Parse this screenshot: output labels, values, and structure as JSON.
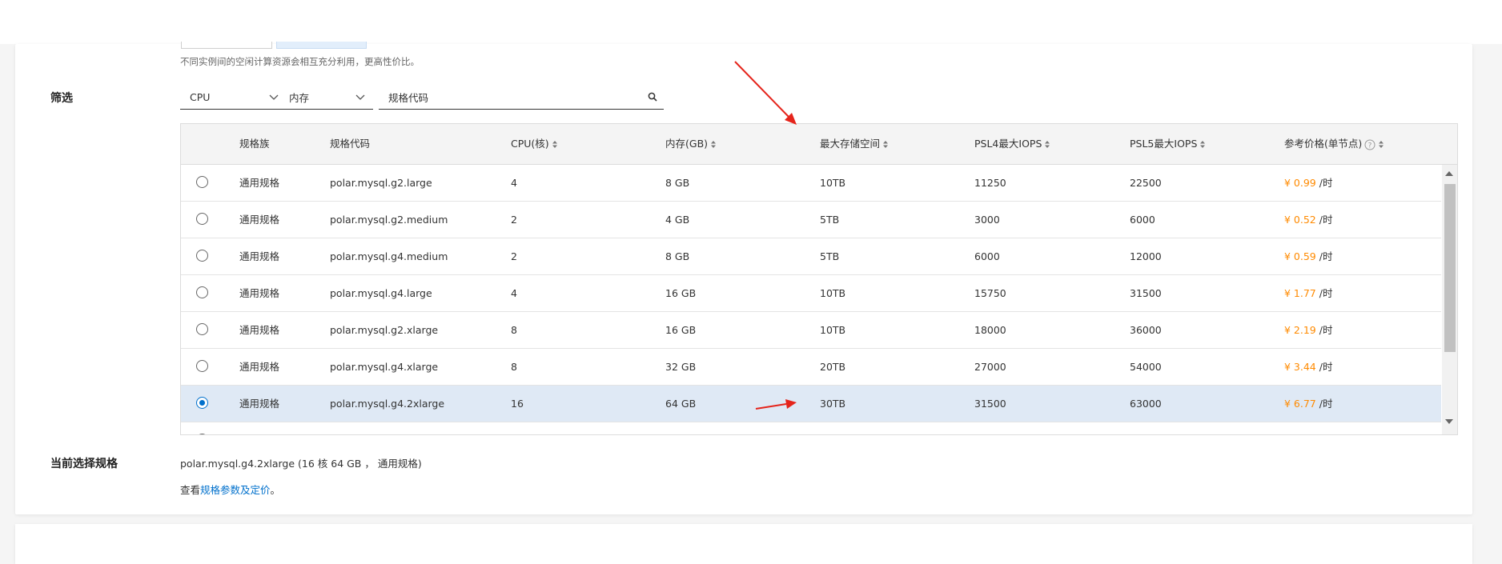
{
  "hint": "不同实例间的空闲计算资源会相互充分利用，更高性价比。",
  "filter": {
    "label": "筛选",
    "cpu_select": "CPU",
    "memory_select": "内存",
    "search_placeholder": "规格代码"
  },
  "table": {
    "columns": [
      "规格族",
      "规格代码",
      "CPU(核)",
      "内存(GB)",
      "最大存储空间",
      "PSL4最大IOPS",
      "PSL5最大IOPS",
      "参考价格(单节点)"
    ],
    "rows": [
      {
        "family": "通用规格",
        "code": "polar.mysql.g2.large",
        "cpu": "4",
        "memory": "8 GB",
        "storage": "10TB",
        "psl4": "11250",
        "psl5": "22500",
        "price": "¥ 0.99",
        "unit": "/时",
        "selected": false
      },
      {
        "family": "通用规格",
        "code": "polar.mysql.g2.medium",
        "cpu": "2",
        "memory": "4 GB",
        "storage": "5TB",
        "psl4": "3000",
        "psl5": "6000",
        "price": "¥ 0.52",
        "unit": "/时",
        "selected": false
      },
      {
        "family": "通用规格",
        "code": "polar.mysql.g4.medium",
        "cpu": "2",
        "memory": "8 GB",
        "storage": "5TB",
        "psl4": "6000",
        "psl5": "12000",
        "price": "¥ 0.59",
        "unit": "/时",
        "selected": false
      },
      {
        "family": "通用规格",
        "code": "polar.mysql.g4.large",
        "cpu": "4",
        "memory": "16 GB",
        "storage": "10TB",
        "psl4": "15750",
        "psl5": "31500",
        "price": "¥ 1.77",
        "unit": "/时",
        "selected": false
      },
      {
        "family": "通用规格",
        "code": "polar.mysql.g2.xlarge",
        "cpu": "8",
        "memory": "16 GB",
        "storage": "10TB",
        "psl4": "18000",
        "psl5": "36000",
        "price": "¥ 2.19",
        "unit": "/时",
        "selected": false
      },
      {
        "family": "通用规格",
        "code": "polar.mysql.g4.xlarge",
        "cpu": "8",
        "memory": "32 GB",
        "storage": "20TB",
        "psl4": "27000",
        "psl5": "54000",
        "price": "¥ 3.44",
        "unit": "/时",
        "selected": false
      },
      {
        "family": "通用规格",
        "code": "polar.mysql.g4.2xlarge",
        "cpu": "16",
        "memory": "64 GB",
        "storage": "30TB",
        "psl4": "31500",
        "psl5": "63000",
        "price": "¥ 6.77",
        "unit": "/时",
        "selected": true
      }
    ]
  },
  "current": {
    "label": "当前选择规格",
    "value": "polar.mysql.g4.2xlarge (16 核 64 GB ， 通用规格)"
  },
  "more": {
    "prefix": "查看",
    "link": "规格参数及定价",
    "suffix": "。"
  },
  "colors": {
    "accent": "#0070cc",
    "price": "#ff8a00",
    "annotation_arrow": "#e5241b",
    "selected_row": "#dfe9f5"
  }
}
